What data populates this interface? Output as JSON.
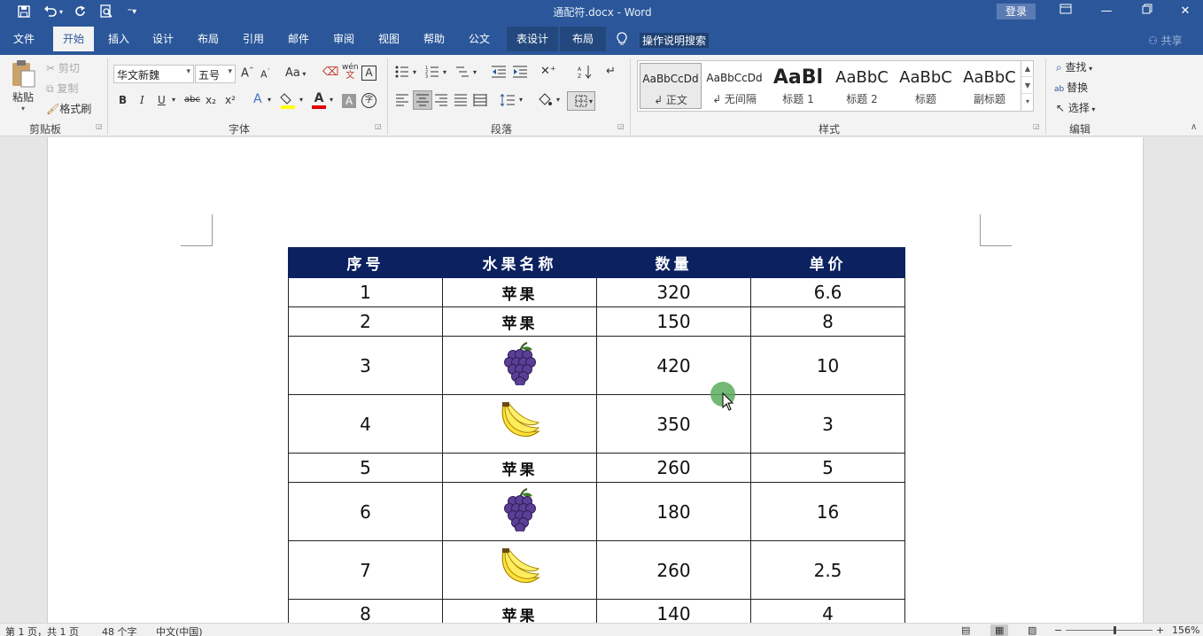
{
  "titlebar": {
    "doc_title": "通配符.docx  -  Word",
    "login_label": "登录"
  },
  "tabs": [
    {
      "label": "文件"
    },
    {
      "label": "开始"
    },
    {
      "label": "插入"
    },
    {
      "label": "设计"
    },
    {
      "label": "布局"
    },
    {
      "label": "引用"
    },
    {
      "label": "邮件"
    },
    {
      "label": "审阅"
    },
    {
      "label": "视图"
    },
    {
      "label": "帮助"
    },
    {
      "label": "公文"
    },
    {
      "label": "表设计"
    },
    {
      "label": "布局"
    }
  ],
  "tell_me": "操作说明搜索",
  "share_label": "共享",
  "clipboard": {
    "paste": "粘贴",
    "cut": "剪切",
    "copy": "复制",
    "format_painter": "格式刷",
    "group_label": "剪贴板"
  },
  "font": {
    "font_name": "华文新魏",
    "font_size": "五号",
    "change_case": "Aa",
    "phonetic": "wén",
    "group_label": "字体",
    "bold": "B",
    "italic": "I",
    "underline": "U",
    "strike": "abc",
    "subscript": "x₂",
    "superscript": "x²",
    "grow": "A",
    "shrink": "A",
    "border_char": "A",
    "shade_char": "A",
    "enclose": "字"
  },
  "paragraph": {
    "group_label": "段落"
  },
  "styles": {
    "group_label": "样式",
    "items": [
      {
        "preview": "AaBbCcDd",
        "name": "↲ 正文"
      },
      {
        "preview": "AaBbCcDd",
        "name": "↲ 无间隔"
      },
      {
        "preview": "AaBl",
        "name": "标题 1"
      },
      {
        "preview": "AaBbC",
        "name": "标题 2"
      },
      {
        "preview": "AaBbC",
        "name": "标题"
      },
      {
        "preview": "AaBbC",
        "name": "副标题"
      }
    ]
  },
  "editing": {
    "find": "查找",
    "replace": "替换",
    "select": "选择",
    "group_label": "编辑"
  },
  "table": {
    "headers": [
      "序号",
      "水果名称",
      "数量",
      "单价"
    ],
    "rows": [
      {
        "no": "1",
        "fruit": "苹果",
        "fruit_kind": "text",
        "qty": "320",
        "price": "6.6"
      },
      {
        "no": "2",
        "fruit": "苹果",
        "fruit_kind": "text",
        "qty": "150",
        "price": "8"
      },
      {
        "no": "3",
        "fruit": "grape-icon",
        "fruit_kind": "grape",
        "qty": "420",
        "price": "10"
      },
      {
        "no": "4",
        "fruit": "banana-icon",
        "fruit_kind": "banana",
        "qty": "350",
        "price": "3"
      },
      {
        "no": "5",
        "fruit": "苹果",
        "fruit_kind": "text",
        "qty": "260",
        "price": "5"
      },
      {
        "no": "6",
        "fruit": "grape-icon",
        "fruit_kind": "grape",
        "qty": "180",
        "price": "16"
      },
      {
        "no": "7",
        "fruit": "banana-icon",
        "fruit_kind": "banana",
        "qty": "260",
        "price": "2.5"
      },
      {
        "no": "8",
        "fruit": "苹果",
        "fruit_kind": "text",
        "qty": "140",
        "price": "4"
      }
    ]
  },
  "statusbar": {
    "page": "第 1 页，共 1 页",
    "words": "48 个字",
    "language": "中文(中国)",
    "zoom": "156%"
  },
  "colors": {
    "accent": "#2b579a",
    "table_header": "#0b2160"
  }
}
